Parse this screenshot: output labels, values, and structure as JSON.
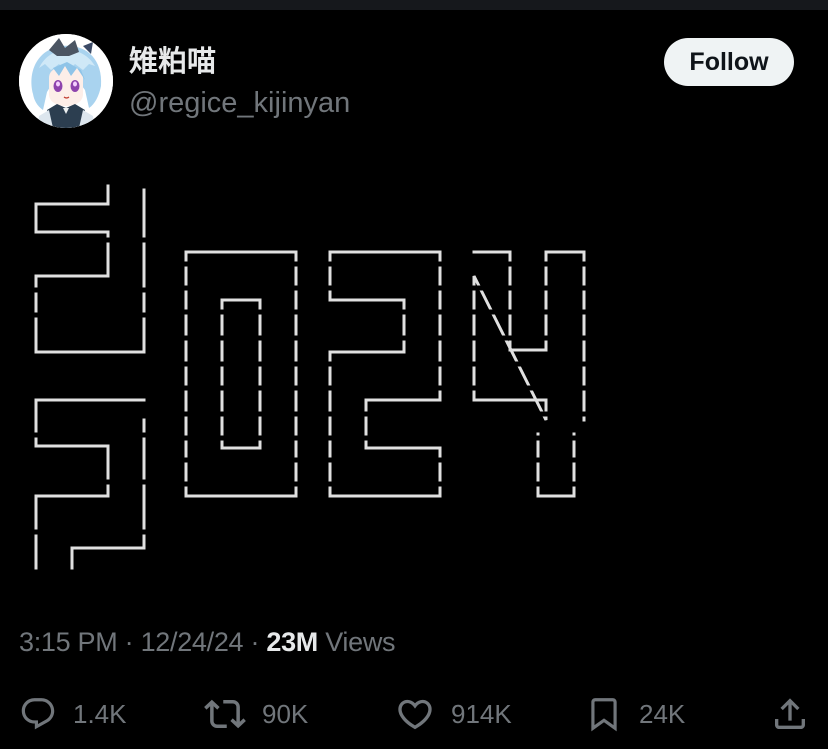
{
  "account": {
    "display_name": "雉粕喵",
    "handle": "@regice_kijinyan",
    "follow_label": "Follow",
    "avatar_icon": "anime-avatar"
  },
  "post": {
    "art_description_text": "",
    "time": "3:15 PM",
    "separator": "·",
    "date": "12/24/24",
    "views_count": "23M",
    "views_label": "Views"
  },
  "actions": {
    "replies": {
      "icon": "reply-icon",
      "count": "1.4K"
    },
    "reposts": {
      "icon": "repost-icon",
      "count": "90K"
    },
    "likes": {
      "icon": "heart-icon",
      "count": "914K"
    },
    "bookmarks": {
      "icon": "bookmark-icon",
      "count": "24K"
    },
    "share": {
      "icon": "share-icon"
    }
  },
  "colors": {
    "background": "#000000",
    "primary_text": "#e7e9ea",
    "secondary_text": "#71767b",
    "follow_bg": "#eff3f4",
    "follow_text": "#0f1419",
    "art_stroke": "#e0e0e0"
  }
}
